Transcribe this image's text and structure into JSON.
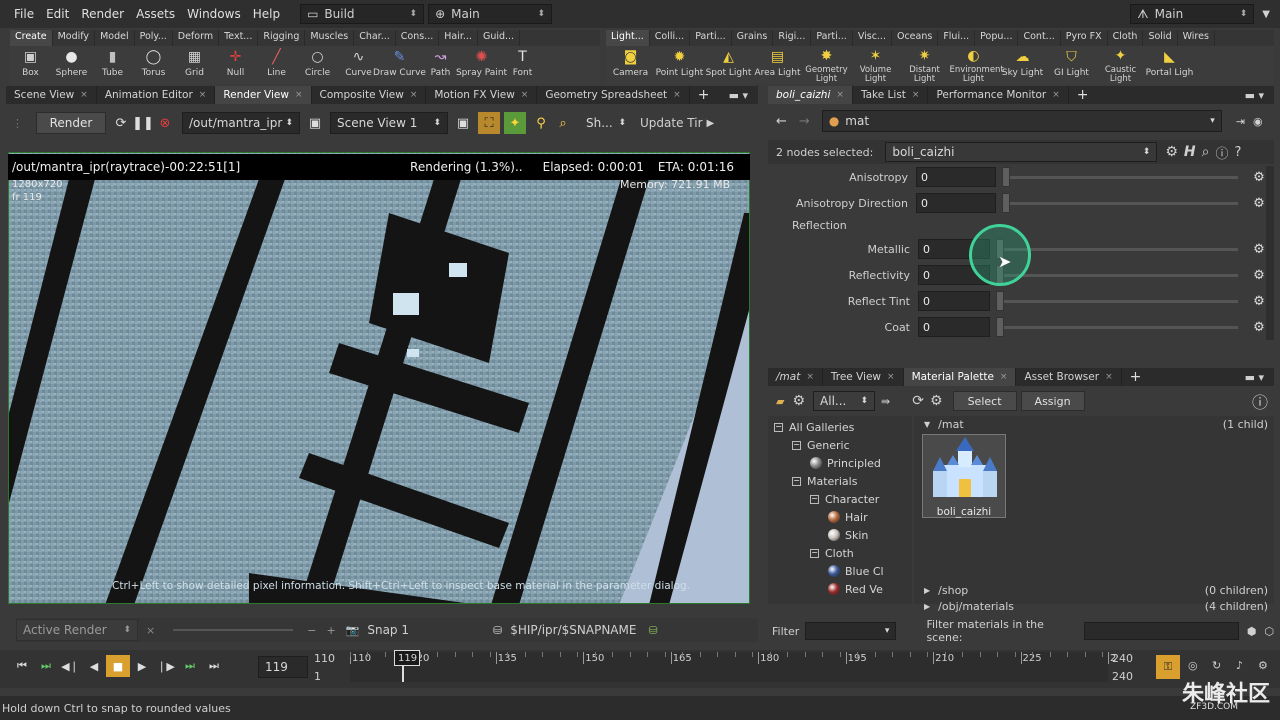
{
  "menubar": {
    "items": [
      "File",
      "Edit",
      "Render",
      "Assets",
      "Windows",
      "Help"
    ],
    "desktop_left": "Build",
    "desktop_mid": "Main",
    "desktop_right": "Main"
  },
  "shelf_tabs_left": [
    "Create",
    "Modify",
    "Model",
    "Poly...",
    "Deform",
    "Text...",
    "Rigging",
    "Muscles",
    "Char...",
    "Cons...",
    "Hair...",
    "Guid..."
  ],
  "shelf_tabs_right": [
    "Light...",
    "Colli...",
    "Parti...",
    "Grains",
    "Rigi...",
    "Parti...",
    "Visc...",
    "Oceans",
    "Flui...",
    "Popu...",
    "Cont...",
    "Pyro FX",
    "Cloth",
    "Solid",
    "Wires"
  ],
  "shelf_tools_left": [
    "Box",
    "Sphere",
    "Tube",
    "Torus",
    "Grid",
    "Null",
    "Line",
    "Circle",
    "Curve",
    "Draw Curve",
    "Path",
    "Spray Paint",
    "Font"
  ],
  "shelf_tools_right": [
    "Camera",
    "Point Light",
    "Spot Light",
    "Area Light",
    "Geometry Light",
    "Volume Light",
    "Distant Light",
    "Environment Light",
    "Sky Light",
    "GI Light",
    "Caustic Light",
    "Portal Ligh"
  ],
  "left_pane_tabs": [
    "Scene View",
    "Animation Editor",
    "Render View",
    "Composite View",
    "Motion FX View",
    "Geometry Spreadsheet"
  ],
  "render_toolbar": {
    "render_label": "Render",
    "output_path": "/out/mantra_ipr",
    "camera": "Scene View 1",
    "sh_label": "Sh...",
    "update_label": "Update Tir"
  },
  "viewport": {
    "title": "/out/mantra_ipr(raytrace)-00:22:51[1]",
    "progress": "Rendering (1.3%)..",
    "elapsed": "Elapsed: 0:00:01",
    "eta": "ETA: 0:01:16",
    "resolution": "1280x720",
    "frame": "fr 119",
    "memory": "Memory:  721.91 MB",
    "hint": "Ctrl+Left to show detailed pixel information. Shift+Ctrl+Left to inspect base material in the parameter dialog."
  },
  "render_bottom": {
    "active_render": "Active Render",
    "snap": "Snap  1",
    "snap_path": "$HIP/ipr/$SNAPNAME"
  },
  "right_top_tabs": [
    "boli_caizhi",
    "Take List",
    "Performance Monitor"
  ],
  "param_path": "mat",
  "nodes_selected": "2 nodes selected:",
  "node_name": "boli_caizhi",
  "params": [
    {
      "label": "Anisotropy",
      "value": "0"
    },
    {
      "label": "Anisotropy Direction",
      "value": "0"
    }
  ],
  "reflection_section": "Reflection",
  "reflection_params": [
    {
      "label": "Metallic",
      "value": "0"
    },
    {
      "label": "Reflectivity",
      "value": "0"
    },
    {
      "label": "Reflect Tint",
      "value": "0"
    },
    {
      "label": "Coat",
      "value": "0"
    }
  ],
  "right_bottom_tabs": [
    "/mat",
    "Tree View",
    "Material Palette",
    "Asset Browser"
  ],
  "palette": {
    "filter_all": "All...",
    "select_label": "Select",
    "assign_label": "Assign",
    "mat_path": "/mat",
    "mat_count": "(1 child)",
    "material_name": "boli_caizhi",
    "shop_path": "/shop",
    "shop_count": "(0 children)",
    "objmat_path": "/obj/materials",
    "objmat_count": "(4 children)",
    "filter_label": "Filter",
    "filter_scene_label": "Filter materials in the scene:"
  },
  "gallery_tree": [
    {
      "label": "All Galleries",
      "level": 0,
      "box": "−"
    },
    {
      "label": "Generic",
      "level": 1,
      "box": "−"
    },
    {
      "label": "Principled",
      "level": 2,
      "ball": "#8a8a8a"
    },
    {
      "label": "Materials",
      "level": 1,
      "box": "−"
    },
    {
      "label": "Character",
      "level": 2,
      "box": "−"
    },
    {
      "label": "Hair",
      "level": 3,
      "ball": "#b5683a"
    },
    {
      "label": "Skin",
      "level": 3,
      "ball": "#c9c3bc"
    },
    {
      "label": "Cloth",
      "level": 2,
      "box": "−"
    },
    {
      "label": "Blue Cl",
      "level": 3,
      "ball": "#3a5a9a"
    },
    {
      "label": "Red Ve",
      "level": 3,
      "ball": "#9a2a2a"
    }
  ],
  "timeline": {
    "current_frame": "119",
    "start": "110",
    "start2": "1",
    "end": "240",
    "end2": "240",
    "ticks": [
      "110",
      "120",
      "135",
      "150",
      "165",
      "180",
      "195",
      "210",
      "225",
      "2"
    ],
    "marker": "119"
  },
  "status": "Hold down Ctrl to snap to rounded values",
  "watermark": "朱峰社区",
  "watermark_url": "ZF3D.COM"
}
